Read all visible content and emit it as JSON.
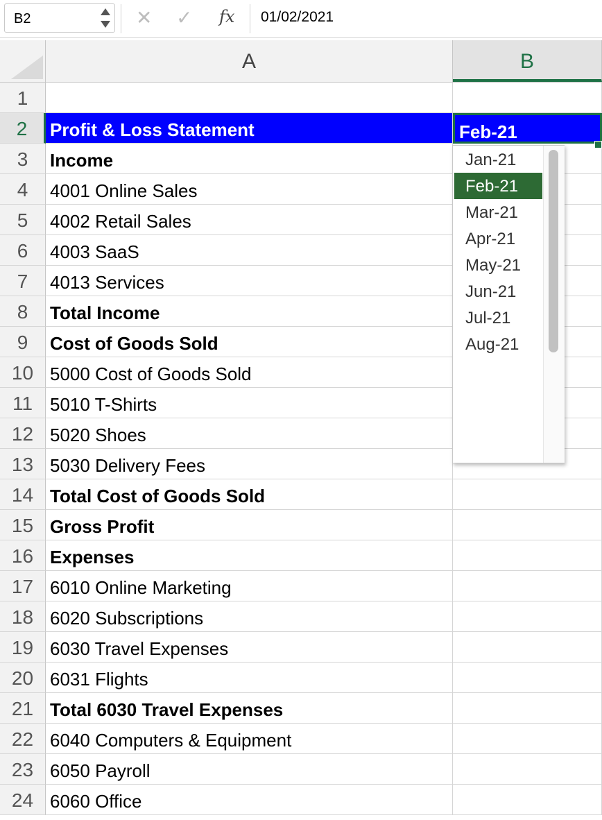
{
  "formula_bar": {
    "name_box": "B2",
    "cancel_glyph": "✕",
    "enter_glyph": "✓",
    "fx_label": "fx",
    "value": "01/02/2021"
  },
  "columns": [
    "A",
    "B"
  ],
  "rows": [
    {
      "num": "1",
      "a": "",
      "style": "normal"
    },
    {
      "num": "2",
      "a": "Profit & Loss Statement",
      "b": "Feb-21",
      "style": "title"
    },
    {
      "num": "3",
      "a": "Income",
      "style": "bold"
    },
    {
      "num": "4",
      "a": "4001 Online Sales",
      "style": "normal"
    },
    {
      "num": "5",
      "a": "4002 Retail Sales",
      "style": "normal"
    },
    {
      "num": "6",
      "a": "4003 SaaS",
      "style": "normal"
    },
    {
      "num": "7",
      "a": "4013 Services",
      "style": "normal"
    },
    {
      "num": "8",
      "a": "Total Income",
      "style": "bold"
    },
    {
      "num": "9",
      "a": "Cost of Goods Sold",
      "style": "bold"
    },
    {
      "num": "10",
      "a": "5000 Cost of Goods Sold",
      "style": "normal"
    },
    {
      "num": "11",
      "a": "5010 T-Shirts",
      "style": "normal"
    },
    {
      "num": "12",
      "a": "5020 Shoes",
      "style": "normal"
    },
    {
      "num": "13",
      "a": "5030 Delivery Fees",
      "style": "normal"
    },
    {
      "num": "14",
      "a": "Total Cost of Goods Sold",
      "style": "bold"
    },
    {
      "num": "15",
      "a": "Gross Profit",
      "style": "bold"
    },
    {
      "num": "16",
      "a": "Expenses",
      "style": "bold"
    },
    {
      "num": "17",
      "a": "6010 Online Marketing",
      "style": "normal"
    },
    {
      "num": "18",
      "a": "6020 Subscriptions",
      "style": "normal"
    },
    {
      "num": "19",
      "a": "6030 Travel Expenses",
      "style": "normal"
    },
    {
      "num": "20",
      "a": "6031 Flights",
      "style": "normal"
    },
    {
      "num": "21",
      "a": "Total 6030 Travel Expenses",
      "style": "bold"
    },
    {
      "num": "22",
      "a": "6040 Computers & Equipment",
      "style": "normal"
    },
    {
      "num": "23",
      "a": "6050 Payroll",
      "style": "normal"
    },
    {
      "num": "24",
      "a": "6060 Office",
      "style": "normal"
    }
  ],
  "dropdown": {
    "options": [
      "Jan-21",
      "Feb-21",
      "Mar-21",
      "Apr-21",
      "May-21",
      "Jun-21",
      "Jul-21",
      "Aug-21"
    ],
    "selected": "Feb-21"
  },
  "colors": {
    "title_fill": "#0000ff",
    "selection_green": "#1e7145",
    "dropdown_selected": "#2d6a34"
  }
}
